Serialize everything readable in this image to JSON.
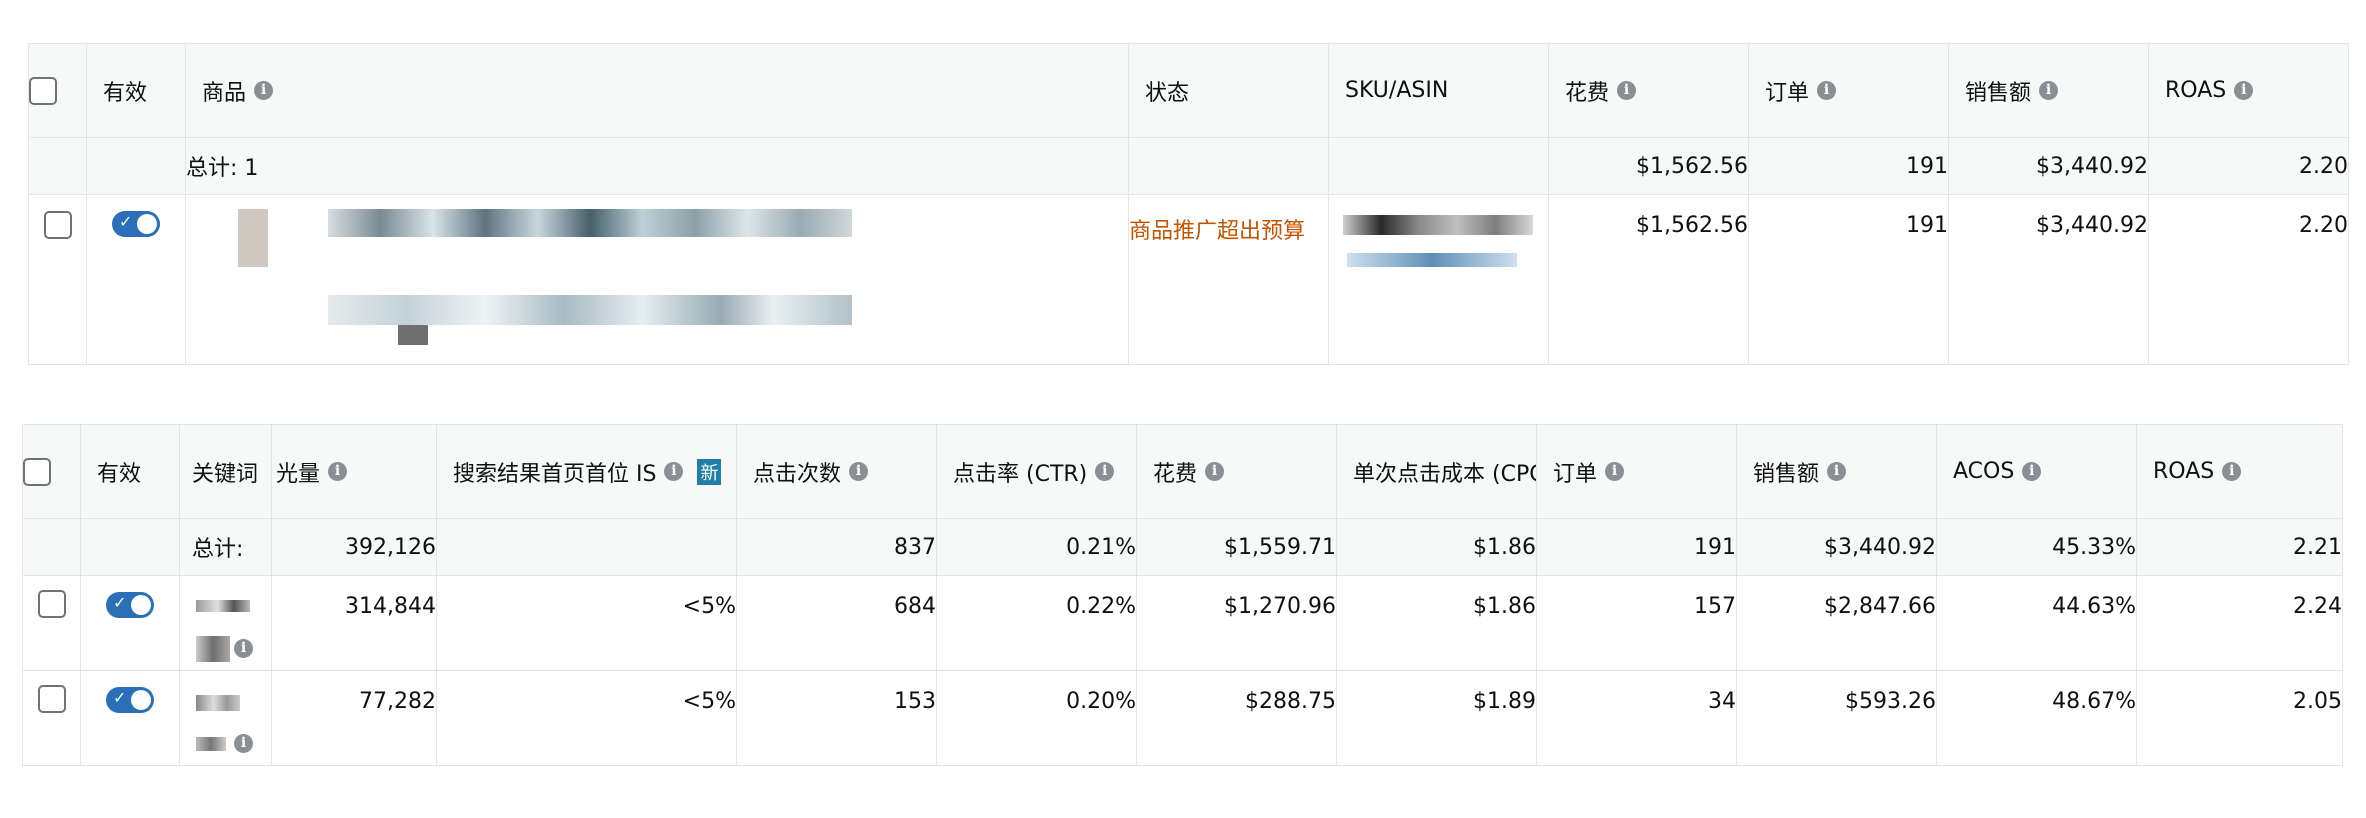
{
  "product_table": {
    "headers": {
      "active": "有效",
      "product": "商品",
      "status": "状态",
      "sku": "SKU/ASIN",
      "spend": "花费",
      "orders": "订单",
      "sales": "销售额",
      "roas": "ROAS"
    },
    "total": {
      "label": "总计: 1",
      "spend": "$1,562.56",
      "orders": "191",
      "sales": "$3,440.92",
      "roas": "2.20"
    },
    "rows": [
      {
        "status": "商品推广超出预算",
        "spend": "$1,562.56",
        "orders": "191",
        "sales": "$3,440.92",
        "roas": "2.20"
      }
    ]
  },
  "keyword_table": {
    "headers": {
      "active": "有效",
      "keyword": "关键词",
      "impressions": "光量",
      "top_is": "搜索结果首页首位 IS",
      "top_is_badge": "新",
      "clicks": "点击次数",
      "ctr": "点击率 (CTR)",
      "spend": "花费",
      "cpc": "单次点击成本 (CPC",
      "orders": "订单",
      "sales": "销售额",
      "acos": "ACOS",
      "roas": "ROAS"
    },
    "total": {
      "label": "总计:",
      "impressions": "392,126",
      "clicks": "837",
      "ctr": "0.21%",
      "spend": "$1,559.71",
      "cpc": "$1.86",
      "orders": "191",
      "sales": "$3,440.92",
      "acos": "45.33%",
      "roas": "2.21"
    },
    "rows": [
      {
        "impressions": "314,844",
        "top_is": "<5%",
        "clicks": "684",
        "ctr": "0.22%",
        "spend": "$1,270.96",
        "cpc": "$1.86",
        "orders": "157",
        "sales": "$2,847.66",
        "acos": "44.63%",
        "roas": "2.24"
      },
      {
        "impressions": "77,282",
        "top_is": "<5%",
        "clicks": "153",
        "ctr": "0.20%",
        "spend": "$288.75",
        "cpc": "$1.89",
        "orders": "34",
        "sales": "$593.26",
        "acos": "48.67%",
        "roas": "2.05"
      }
    ]
  },
  "icons": {
    "info": "info-icon",
    "checkbox": "checkbox-icon",
    "toggle": "toggle-switch"
  },
  "colors": {
    "toggle_on": "#2a6fb8",
    "status_warning": "#c45500",
    "header_bg": "#f7f8f8",
    "border": "#e3e6e6"
  }
}
